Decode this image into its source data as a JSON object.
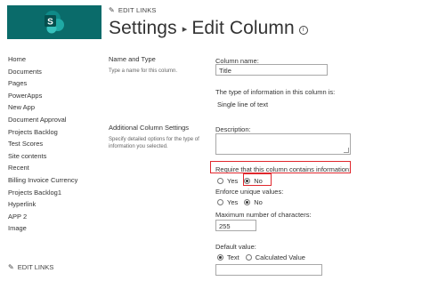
{
  "nav": {
    "items": [
      "Home",
      "Documents",
      "Pages",
      "PowerApps",
      "New App",
      "Document Approval",
      "Projects Backlog",
      "Test Scores",
      "Site contents",
      "Recent",
      "Billing Invoice Currency",
      "Projects Backlog1",
      "Hyperlink",
      "APP 2",
      "Image"
    ],
    "edit_links": "EDIT LINKS"
  },
  "header": {
    "edit_links": "EDIT LINKS",
    "title_part1": "Settings",
    "title_sep": "▸",
    "title_part2": "Edit Column",
    "info_icon": "i"
  },
  "sections": {
    "name_type": {
      "title": "Name and Type",
      "desc": "Type a name for this column."
    },
    "additional": {
      "title": "Additional Column Settings",
      "desc": "Specify detailed options for the type of information you selected."
    }
  },
  "form": {
    "column_name_label": "Column name:",
    "column_name_value": "Title",
    "type_info_label": "The type of information in this column is:",
    "type_info_value": "Single line of text",
    "description_label": "Description:",
    "require_label": "Require that this column contains information:",
    "require_yes": "Yes",
    "require_no": "No",
    "unique_label": "Enforce unique values:",
    "unique_yes": "Yes",
    "unique_no": "No",
    "max_chars_label": "Maximum number of characters:",
    "max_chars_value": "255",
    "default_label": "Default value:",
    "default_text": "Text",
    "default_calc": "Calculated Value"
  },
  "colors": {
    "logo_bg": "#0a6b6a",
    "highlight": "#e0282e"
  }
}
